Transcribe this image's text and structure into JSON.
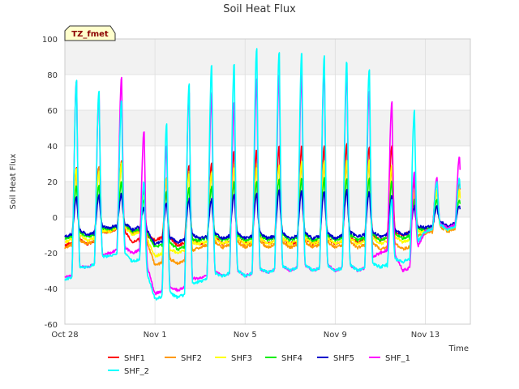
{
  "chart_data": {
    "type": "line",
    "title": "Soil Heat Flux",
    "xlabel": "Time",
    "ylabel": "Soil Heat Flux",
    "badge": "TZ_fmet",
    "ylim": [
      -60,
      100
    ],
    "yticks": [
      -60,
      -40,
      -20,
      0,
      20,
      40,
      60,
      80,
      100
    ],
    "xlim": [
      0,
      18
    ],
    "xticks": [
      {
        "x": 0,
        "label": "Oct 28"
      },
      {
        "x": 4,
        "label": "Nov 1"
      },
      {
        "x": 8,
        "label": "Nov 5"
      },
      {
        "x": 12,
        "label": "Nov 9"
      },
      {
        "x": 16,
        "label": "Nov 13"
      }
    ],
    "grid": true,
    "legend_position": "bottom",
    "x_units": "days since Oct 28",
    "series": [
      {
        "name": "SHF1",
        "color": "#ff0000",
        "night": [
          -16,
          -15,
          -8,
          -14,
          -13,
          -16,
          -15,
          -15,
          -15,
          -15,
          -15,
          -15,
          -15,
          -14,
          -13,
          -10,
          -7,
          -6
        ],
        "peak": [
          28,
          29,
          32,
          15,
          14,
          30,
          30,
          38,
          38,
          40,
          40,
          40,
          41,
          40,
          40,
          20,
          20,
          20
        ]
      },
      {
        "name": "SHF2",
        "color": "#ff9900",
        "night": [
          -17,
          -15,
          -8,
          -9,
          -27,
          -26,
          -17,
          -17,
          -17,
          -17,
          -17,
          -17,
          -17,
          -17,
          -18,
          -18,
          -9,
          -8
        ],
        "peak": [
          25,
          28,
          31,
          12,
          22,
          26,
          26,
          30,
          30,
          30,
          30,
          30,
          30,
          30,
          28,
          15,
          15,
          15
        ]
      },
      {
        "name": "SHF3",
        "color": "#ffff00",
        "night": [
          -14,
          -13,
          -8,
          -10,
          -22,
          -20,
          -15,
          -15,
          -15,
          -15,
          -15,
          -15,
          -15,
          -15,
          -15,
          -14,
          -8,
          -7
        ],
        "peak": [
          28,
          26,
          30,
          12,
          22,
          25,
          25,
          28,
          28,
          30,
          32,
          32,
          32,
          32,
          30,
          15,
          15,
          15
        ]
      },
      {
        "name": "SHF4",
        "color": "#00ee00",
        "night": [
          -12,
          -11,
          -7,
          -8,
          -17,
          -18,
          -13,
          -13,
          -13,
          -13,
          -13,
          -13,
          -13,
          -13,
          -13,
          -12,
          -7,
          -6
        ],
        "peak": [
          18,
          18,
          20,
          10,
          15,
          17,
          17,
          20,
          20,
          22,
          22,
          22,
          22,
          22,
          20,
          10,
          10,
          10
        ]
      },
      {
        "name": "SHF5",
        "color": "#0000cc",
        "night": [
          -11,
          -10,
          -6,
          -7,
          -15,
          -14,
          -12,
          -12,
          -12,
          -12,
          -12,
          -12,
          -12,
          -11,
          -11,
          -10,
          -6,
          -5
        ],
        "peak": [
          12,
          12,
          13,
          5,
          8,
          10,
          10,
          13,
          13,
          15,
          15,
          15,
          15,
          14,
          12,
          6,
          6,
          6
        ]
      },
      {
        "name": "SHF_1",
        "color": "#ff00ff",
        "night": [
          -34,
          -28,
          -20,
          -20,
          -43,
          -41,
          -34,
          -33,
          -33,
          -31,
          -30,
          -30,
          -30,
          -30,
          -20,
          -30,
          -8,
          -6
        ],
        "peak": [
          78,
          70,
          79,
          49,
          41,
          71,
          70,
          65,
          78,
          80,
          81,
          85,
          82,
          72,
          65,
          25,
          23,
          34
        ]
      },
      {
        "name": "SHF_2",
        "color": "#00ffff",
        "night": [
          -35,
          -28,
          -22,
          -25,
          -46,
          -45,
          -36,
          -33,
          -33,
          -31,
          -30,
          -30,
          -30,
          -30,
          -28,
          -25,
          -8,
          -7
        ],
        "peak": [
          78,
          72,
          66,
          20,
          53,
          75,
          86,
          87,
          95,
          93,
          93,
          91,
          88,
          84,
          10,
          60,
          20,
          22
        ]
      }
    ]
  }
}
